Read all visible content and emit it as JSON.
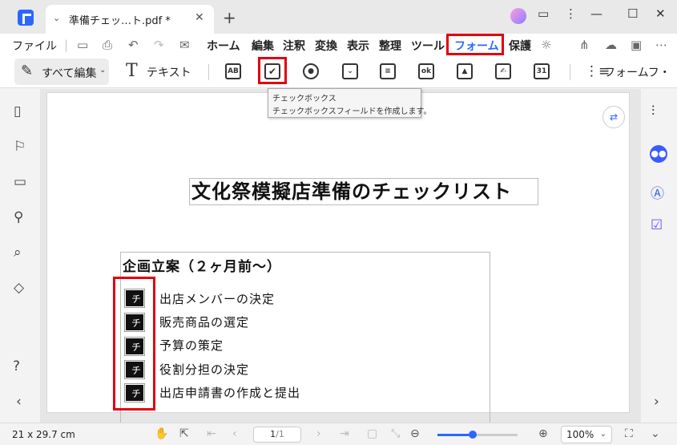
{
  "tab": {
    "title": "準備チェッ…ト.pdf *"
  },
  "menu": {
    "file": "ファイル",
    "items": [
      "ホーム",
      "編集",
      "注釈",
      "変換",
      "表示",
      "整理",
      "ツール",
      "フォーム",
      "保護"
    ],
    "active": "フォーム"
  },
  "toolbar": {
    "edit_all": "すべて編集",
    "text": "テキスト",
    "form_tools": [
      "text-field",
      "checkbox",
      "radio-button",
      "dropdown",
      "list-box",
      "button",
      "image-field",
      "signature-field",
      "date-field"
    ],
    "text_field_glyph": "AB",
    "button_glyph": "ok",
    "date_glyph": "31",
    "form_field_recognition": "フォームフ・"
  },
  "tooltip": {
    "title": "チェックボックス",
    "description": "チェックボックスフィールドを作成します。"
  },
  "document": {
    "title": "文化祭模擬店準備のチェックリスト",
    "section_title": "企画立案（２ヶ月前～）",
    "checkbox_glyph": "チ",
    "items": [
      "出店メンバーの決定",
      "販売商品の選定",
      "予算の策定",
      "役割分担の決定",
      "出店申請書の作成と提出"
    ]
  },
  "status": {
    "page_size": "21 x 29.7 cm",
    "current_page": "1",
    "total_pages": "/1",
    "zoom": "100%",
    "zoom_level": 0.39
  },
  "colors": {
    "accent": "#2b66ff",
    "highlight": "#e2000f"
  }
}
